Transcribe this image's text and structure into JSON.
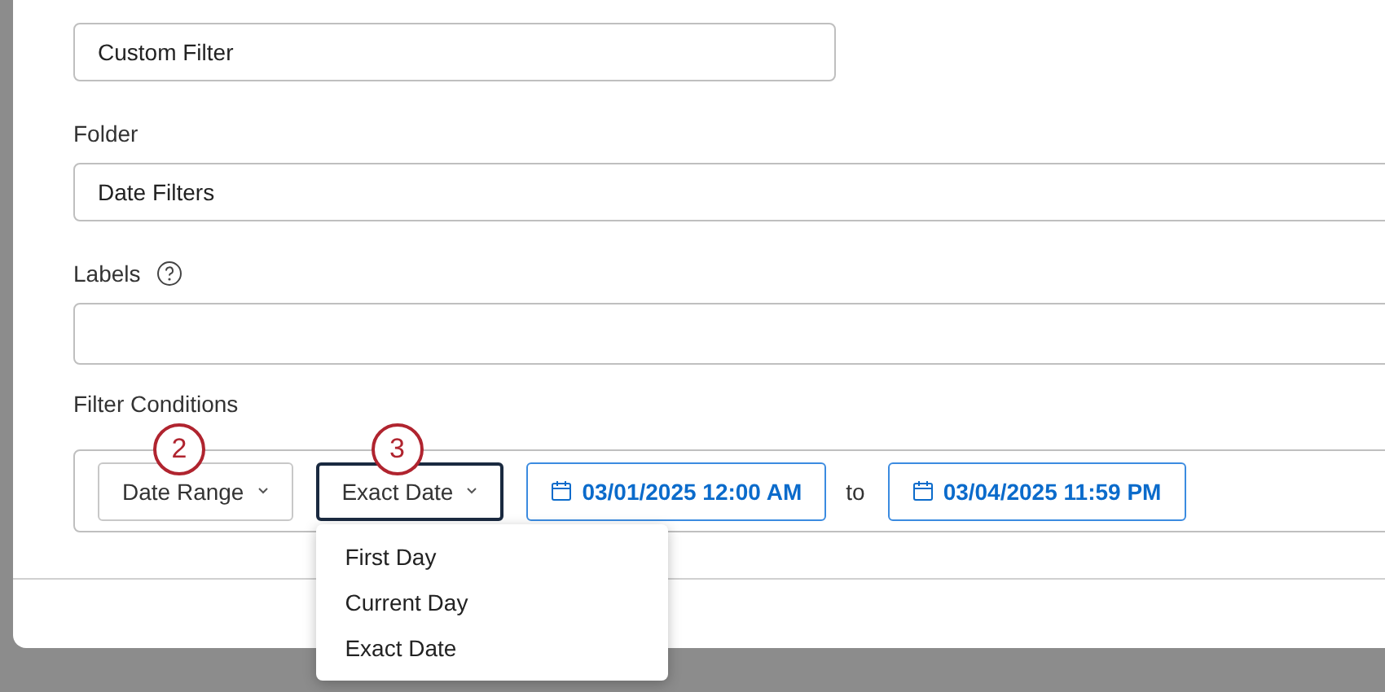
{
  "form": {
    "name_field": {
      "value": "Custom Filter"
    },
    "folder": {
      "label": "Folder",
      "value": "Date Filters"
    },
    "labels": {
      "label": "Labels"
    },
    "filter_conditions": {
      "label": "Filter Conditions",
      "range_type": {
        "label": "Date Range",
        "callout": "2"
      },
      "start_type": {
        "label": "Exact Date",
        "callout": "3",
        "expanded": true,
        "options": [
          {
            "label": "First Day",
            "selected": false
          },
          {
            "label": "Current Day",
            "selected": false
          },
          {
            "label": "Exact Date",
            "selected": false
          }
        ]
      },
      "start_date": "03/01/2025 12:00 AM",
      "separator": "to",
      "end_date": "03/04/2025 11:59 PM"
    }
  }
}
